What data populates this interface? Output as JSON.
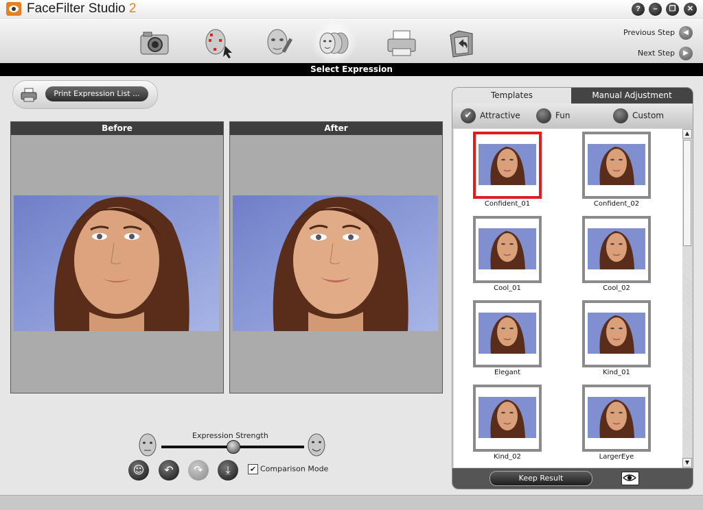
{
  "app": {
    "name": "FaceFilter Studio",
    "version": "2"
  },
  "window_controls": [
    {
      "name": "help-button",
      "glyph": "?"
    },
    {
      "name": "minimize-button",
      "glyph": "–"
    },
    {
      "name": "restore-button",
      "glyph": "❐"
    },
    {
      "name": "close-button",
      "glyph": "✕"
    }
  ],
  "toolbar": {
    "tools": [
      "camera-icon",
      "face-points-icon",
      "face-edit-icon",
      "expression-faces-icon",
      "printer-icon",
      "save-folder-icon"
    ],
    "active_tool": "expression-faces-icon"
  },
  "nav": {
    "previous_label": "Previous Step",
    "next_label": "Next Step"
  },
  "section_title": "Select Expression",
  "print_button_label": "Print Expression List ...",
  "before_label": "Before",
  "after_label": "After",
  "slider": {
    "label": "Expression Strength",
    "value": 0.5
  },
  "comparison_mode": {
    "label": "Comparison Mode",
    "checked": true
  },
  "right_panel": {
    "tabs": [
      "Templates",
      "Manual Adjustment"
    ],
    "active_tab": "Manual Adjustment",
    "categories": [
      "Attractive",
      "Fun",
      "Custom"
    ],
    "selected_category": "Attractive",
    "templates": [
      {
        "label": "Confident_01",
        "selected": true
      },
      {
        "label": "Confident_02",
        "selected": false
      },
      {
        "label": "Cool_01",
        "selected": false
      },
      {
        "label": "Cool_02",
        "selected": false
      },
      {
        "label": "Elegant",
        "selected": false
      },
      {
        "label": "Kind_01",
        "selected": false
      },
      {
        "label": "Kind_02",
        "selected": false
      },
      {
        "label": "LargerEye",
        "selected": false
      }
    ],
    "keep_result_label": "Keep Result"
  },
  "colors": {
    "accent": "#e8801f",
    "selected_border": "#e01e1e",
    "photo_bg": "#7f8fd0",
    "hair": "#5a2c1a",
    "skin": "#d9a07a"
  }
}
